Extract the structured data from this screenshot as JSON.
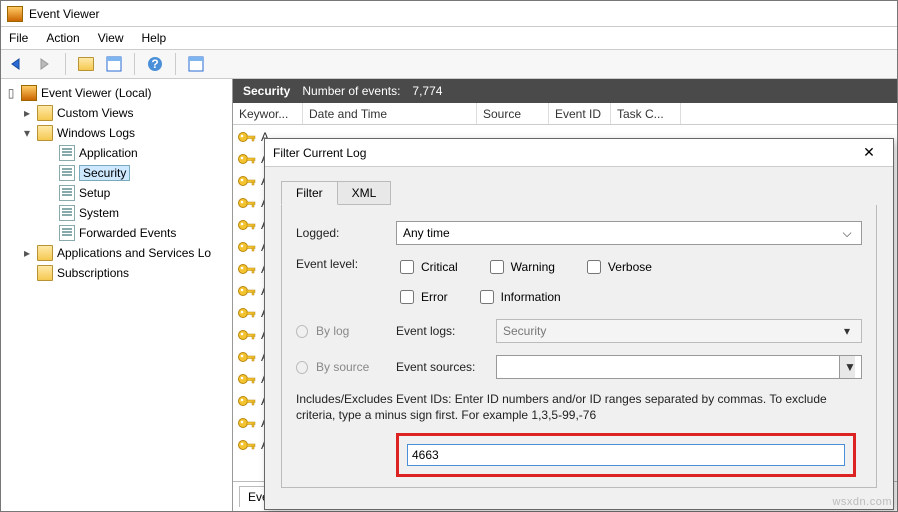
{
  "window": {
    "title": "Event Viewer"
  },
  "menu": {
    "file": "File",
    "action": "Action",
    "view": "View",
    "help": "Help"
  },
  "tree": {
    "root": "Event Viewer (Local)",
    "custom": "Custom Views",
    "winlogs": "Windows Logs",
    "app": "Application",
    "sec": "Security",
    "setup": "Setup",
    "system": "System",
    "fwd": "Forwarded Events",
    "appserv": "Applications and Services Lo",
    "subs": "Subscriptions"
  },
  "header": {
    "title": "Security",
    "count_label": "Number of events:",
    "count_val": "7,774"
  },
  "cols": {
    "keywords": "Keywor...",
    "date": "Date and Time",
    "source": "Source",
    "eventid": "Event ID",
    "taskc": "Task C..."
  },
  "row_audit": "A",
  "detail_tab": "Eve",
  "dialog": {
    "title": "Filter Current Log",
    "tab_filter": "Filter",
    "tab_xml": "XML",
    "logged": "Logged:",
    "logged_val": "Any time",
    "eventlevel": "Event level:",
    "critical": "Critical",
    "warning": "Warning",
    "verbose": "Verbose",
    "error": "Error",
    "information": "Information",
    "bylog": "By log",
    "bysrc": "By source",
    "eventlogs": "Event logs:",
    "eventlogs_val": "Security",
    "eventsources": "Event sources:",
    "hint": "Includes/Excludes Event IDs: Enter ID numbers and/or ID ranges separated by commas. To exclude criteria, type a minus sign first. For example 1,3,5-99,-76",
    "id_value": "4663"
  },
  "watermark": "wsxdn.com"
}
